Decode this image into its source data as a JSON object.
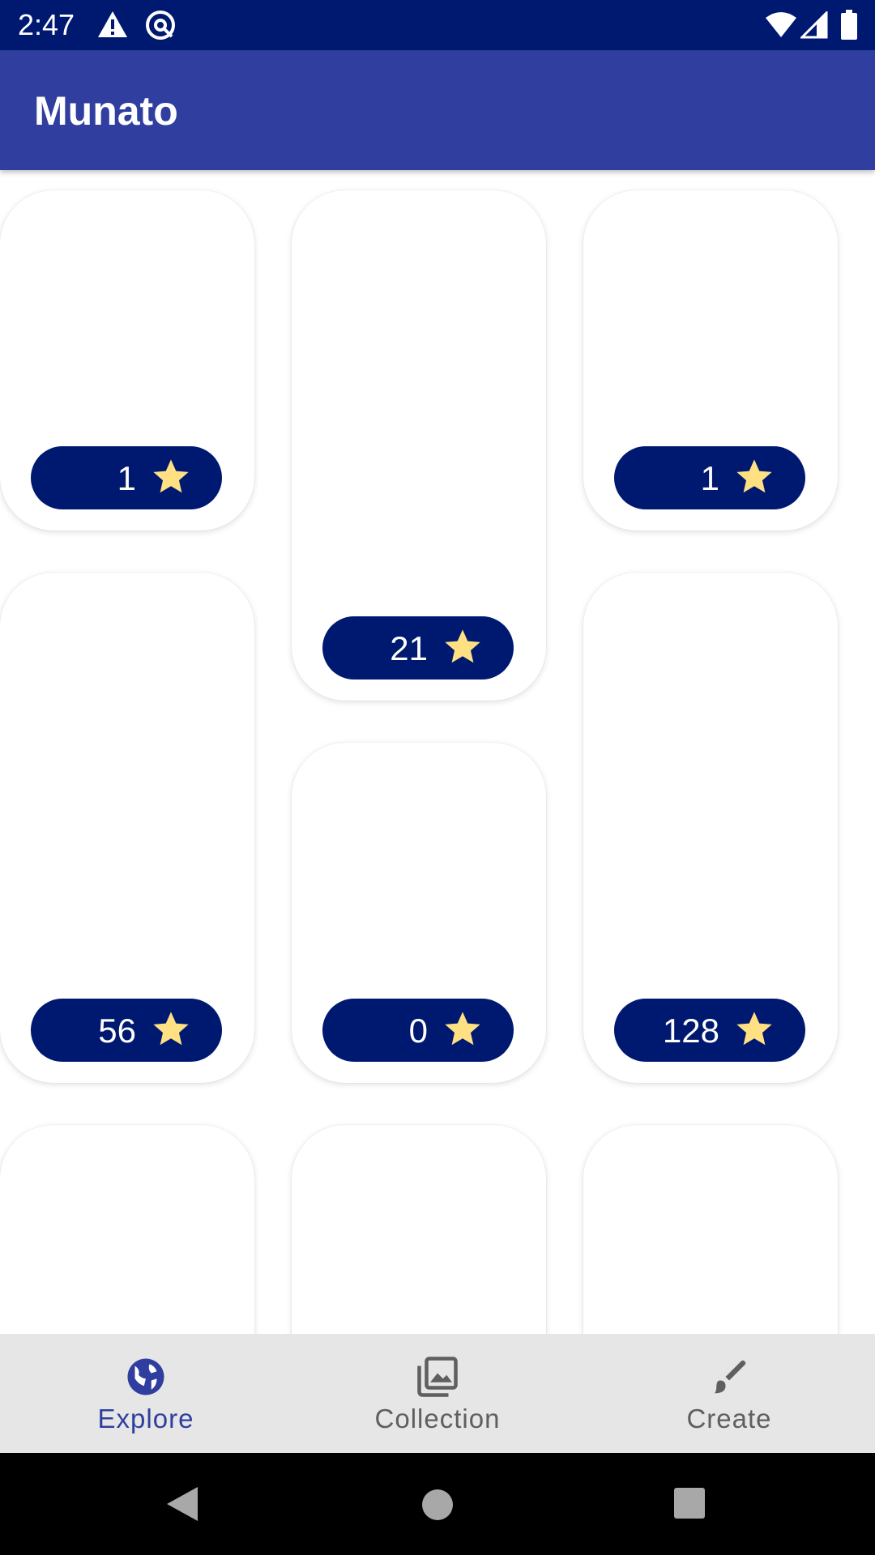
{
  "status_bar": {
    "time": "2:47",
    "icons": [
      "warning-icon",
      "sync-icon",
      "wifi-icon",
      "cellular-signal-icon",
      "battery-icon"
    ]
  },
  "app_bar": {
    "title": "Munato"
  },
  "cards": [
    {
      "stars": "1"
    },
    {
      "stars": "21"
    },
    {
      "stars": "1"
    },
    {
      "stars": "56"
    },
    {
      "stars": "0"
    },
    {
      "stars": "128"
    }
  ],
  "bottom_nav": {
    "items": [
      {
        "label": "Explore",
        "icon": "globe-icon",
        "selected": true
      },
      {
        "label": "Collection",
        "icon": "photo-library-icon",
        "selected": false
      },
      {
        "label": "Create",
        "icon": "brush-icon",
        "selected": false
      }
    ]
  },
  "colors": {
    "status_bar": "#001970",
    "app_bar": "#303f9f",
    "pill": "#001970",
    "star": "#ffe082",
    "nav_selected": "#303f9f",
    "nav_unselected": "#5f5f5f",
    "nav_background": "#e6e6e6"
  },
  "system_nav": {
    "buttons": [
      "back-icon",
      "home-icon",
      "recents-icon"
    ]
  }
}
